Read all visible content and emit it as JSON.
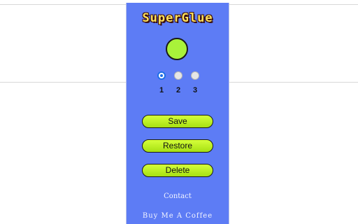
{
  "app": {
    "logo_text": "SuperGlue"
  },
  "colors": {
    "panel_bg": "#5d7cf5",
    "accent_green": "#a9f23a",
    "radio_selected": "#1f6fe8"
  },
  "slots": {
    "selected": "1",
    "options": [
      {
        "label": "1"
      },
      {
        "label": "2"
      },
      {
        "label": "3"
      }
    ]
  },
  "buttons": {
    "save_label": "Save",
    "restore_label": "Restore",
    "delete_label": "Delete"
  },
  "links": {
    "contact_label": "Contact",
    "coffee_label": "Buy Me A Coffee"
  }
}
